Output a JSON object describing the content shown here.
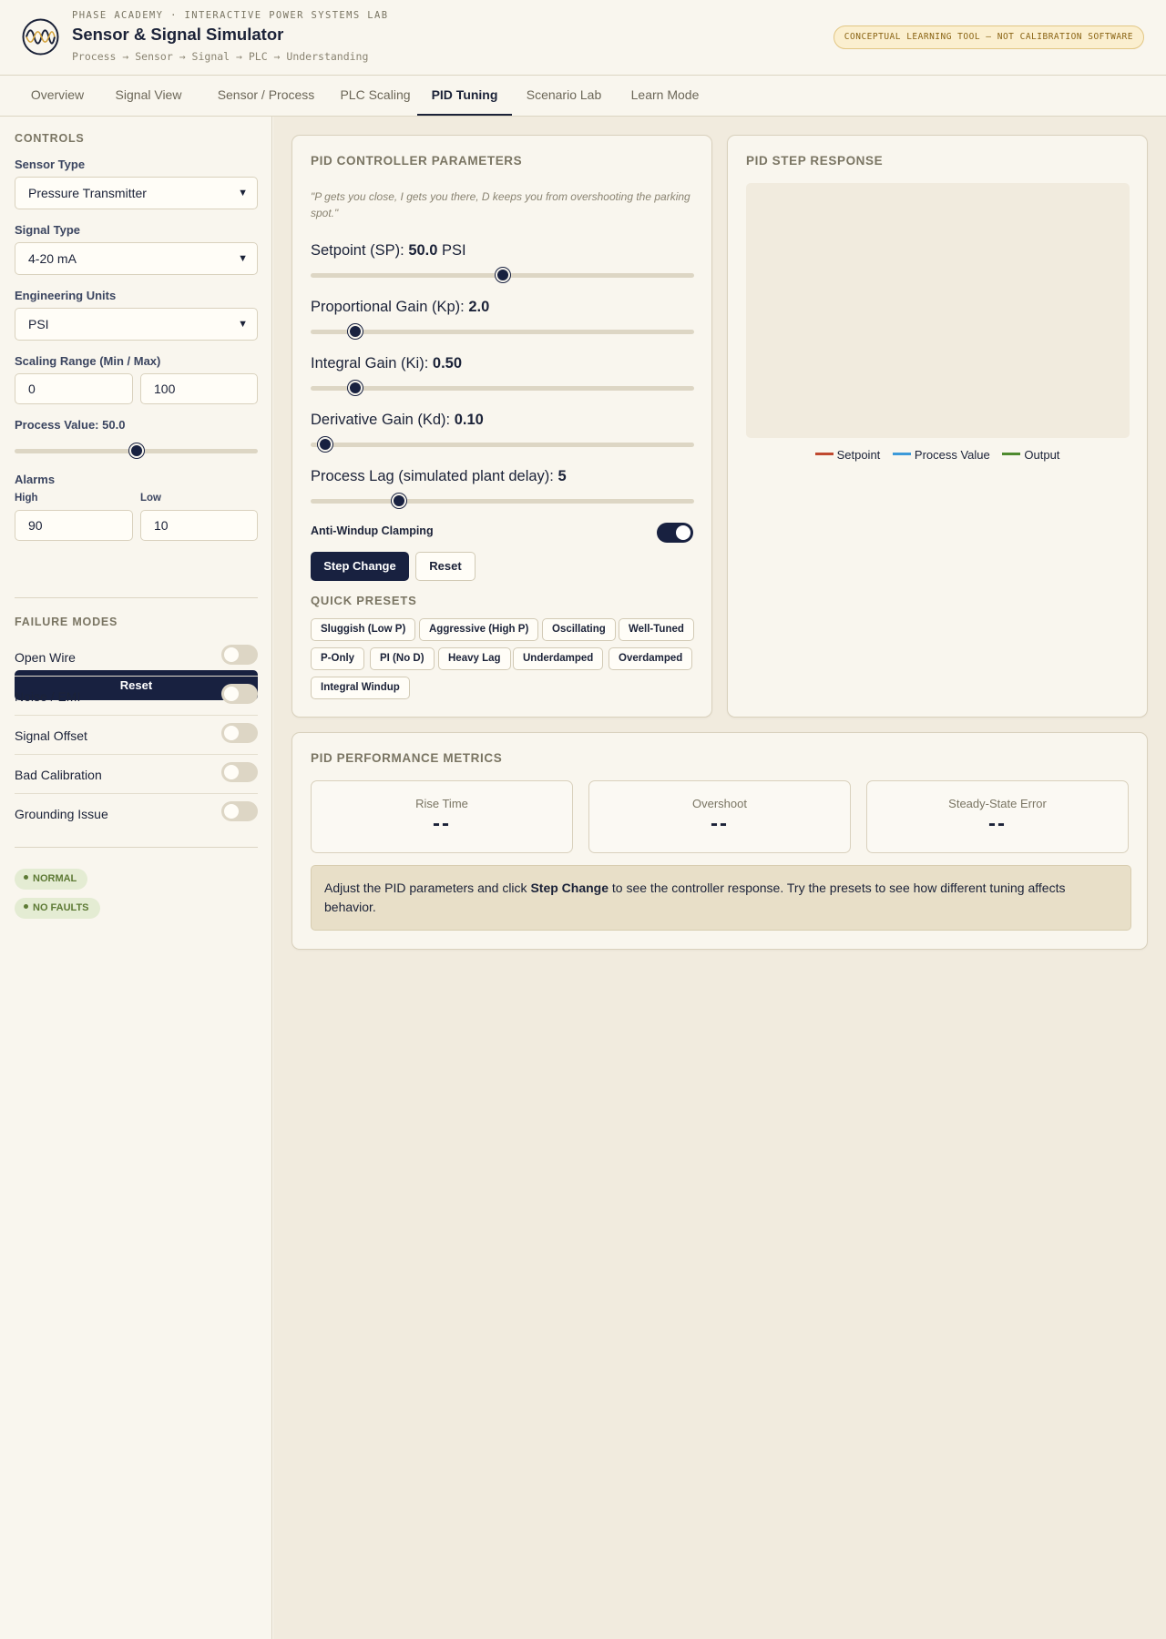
{
  "header": {
    "kicker": "PHASE ACADEMY · INTERACTIVE POWER SYSTEMS LAB",
    "title": "Sensor & Signal Simulator",
    "breadcrumb": "Process → Sensor → Signal → PLC → Understanding",
    "disclaimer": "CONCEPTUAL LEARNING TOOL — NOT CALIBRATION SOFTWARE",
    "logo_icon": "sine-wave-logo-icon"
  },
  "tabs": [
    {
      "label": "Overview"
    },
    {
      "label": "Signal View"
    },
    {
      "label": "Sensor / Process"
    },
    {
      "label": "PLC Scaling"
    },
    {
      "label": "PID Tuning",
      "active": true
    },
    {
      "label": "Scenario Lab"
    },
    {
      "label": "Learn Mode"
    }
  ],
  "sidebar": {
    "controls_heading": "CONTROLS",
    "sensor_type": {
      "label": "Sensor Type",
      "value": "Pressure Transmitter"
    },
    "signal_type": {
      "label": "Signal Type",
      "value": "4-20 mA"
    },
    "units": {
      "label": "Engineering Units",
      "value": "PSI"
    },
    "scaling": {
      "label": "Scaling Range (Min / Max)",
      "min": "0",
      "max": "100"
    },
    "process_value": {
      "label": "Process Value:",
      "value": "50.0",
      "fraction": 0.5
    },
    "alarms": {
      "label": "Alarms",
      "high_label": "High",
      "high": "90",
      "low_label": "Low",
      "low": "10"
    },
    "reset_label": "Reset",
    "failure_heading": "FAILURE MODES",
    "failure_modes": [
      {
        "label": "Open Wire",
        "on": false
      },
      {
        "label": "Noise / EMI",
        "on": false
      },
      {
        "label": "Signal Offset",
        "on": false
      },
      {
        "label": "Bad Calibration",
        "on": false
      },
      {
        "label": "Grounding Issue",
        "on": false
      }
    ],
    "status": [
      "NORMAL",
      "NO FAULTS"
    ]
  },
  "pid": {
    "title": "PID CONTROLLER PARAMETERS",
    "quote": "\"P gets you close, I gets you there, D keeps you from overshooting the parking spot.\"",
    "setpoint": {
      "label": "Setpoint (SP):",
      "value": "50.0",
      "unit": "PSI",
      "fraction": 0.5
    },
    "kp": {
      "label": "Proportional Gain (Kp):",
      "value": "2.0",
      "fraction": 0.1
    },
    "ki": {
      "label": "Integral Gain (Ki):",
      "value": "0.50",
      "fraction": 0.1
    },
    "kd": {
      "label": "Derivative Gain (Kd):",
      "value": "0.10",
      "fraction": 0.02
    },
    "lag": {
      "label": "Process Lag (simulated plant delay):",
      "value": "5",
      "fraction": 0.22
    },
    "anti_windup": {
      "label": "Anti-Windup Clamping",
      "on": true
    },
    "step_label": "Step Change",
    "reset_label": "Reset",
    "presets_heading": "QUICK PRESETS",
    "presets": [
      "Sluggish (Low P)",
      "Aggressive (High P)",
      "Oscillating",
      "Well-Tuned",
      "P-Only",
      "PI (No D)",
      "Heavy Lag",
      "Underdamped",
      "Overdamped",
      "Integral Windup"
    ]
  },
  "response": {
    "title": "PID STEP RESPONSE",
    "legend": [
      {
        "name": "Setpoint",
        "color": "#c0492f"
      },
      {
        "name": "Process Value",
        "color": "#3c9ad9"
      },
      {
        "name": "Output",
        "color": "#4e8a2e"
      }
    ]
  },
  "metrics": {
    "title": "PID PERFORMANCE METRICS",
    "items": [
      {
        "label": "Rise Time",
        "value": "--"
      },
      {
        "label": "Overshoot",
        "value": "--"
      },
      {
        "label": "Steady-State Error",
        "value": "--"
      }
    ],
    "info_pre": "Adjust the PID parameters and click ",
    "info_bold": "Step Change",
    "info_post": " to see the controller response. Try the presets to see how different tuning affects behavior."
  }
}
